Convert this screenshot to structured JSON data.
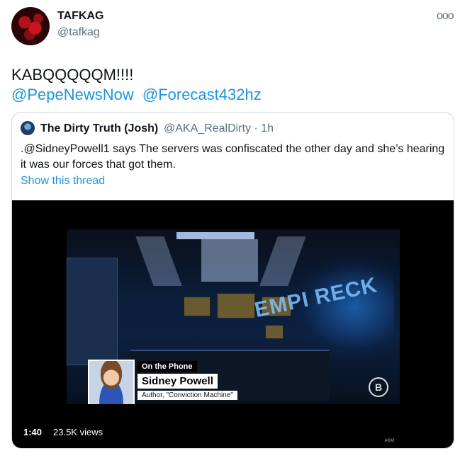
{
  "author": {
    "name": "TAFKAG",
    "handle": "@tafkag"
  },
  "more_label": "ooo",
  "tweet": {
    "text": "KABQQQQQM!!!!",
    "mentions": [
      "@PepeNewsNow",
      "@Forecast432hz"
    ]
  },
  "quoted": {
    "name": "The Dirty Truth (Josh)",
    "handle": "@AKA_RealDirty · 1h",
    "text": ".@SidneyPowell1 says The servers was confiscated the other day and she’s hearing it was our forces that got them.",
    "show_thread": "Show this thread"
  },
  "video": {
    "lower_third": {
      "tag": "On the Phone",
      "name": "Sidney Powell",
      "role": "Author, \"Conviction Machine\""
    },
    "sign_text": "EMPI RECK",
    "logo": "B",
    "duration": "1:40",
    "views": "23.5K views",
    "watermark": "ᴀᴋᴍ"
  }
}
